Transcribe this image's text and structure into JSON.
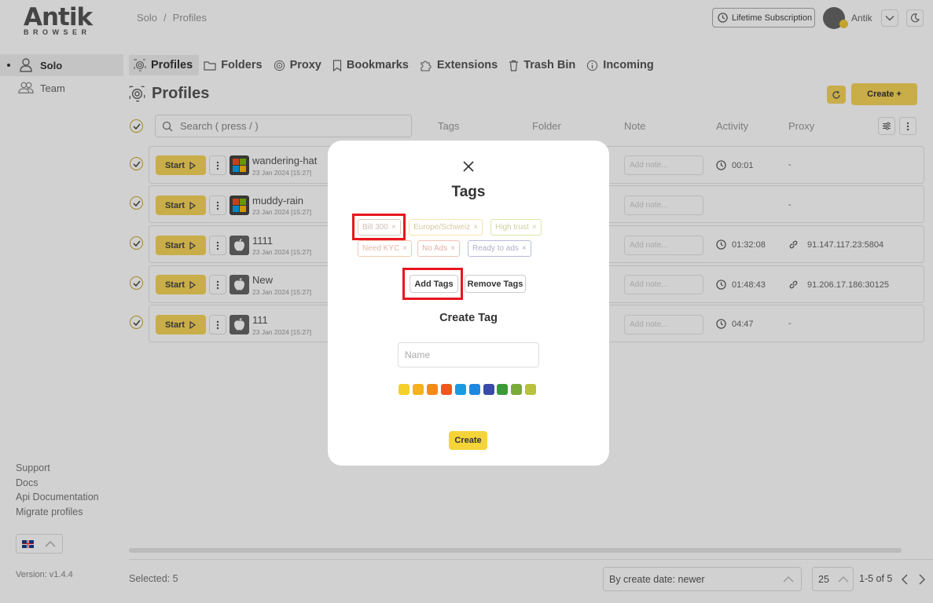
{
  "logo": {
    "main": "Antik",
    "sub": "BROWSER"
  },
  "sidebar": {
    "items": [
      {
        "label": "Solo",
        "active": true
      },
      {
        "label": "Team",
        "active": false
      }
    ],
    "footer_links": [
      "Support",
      "Docs",
      "Api Documentation",
      "Migrate profiles"
    ],
    "version": "Version: v1.4.4"
  },
  "header": {
    "breadcrumb": [
      "Solo",
      "Profiles"
    ],
    "subscription": "Lifetime Subscription",
    "username": "Antik"
  },
  "tabs": [
    "Profiles",
    "Folders",
    "Proxy",
    "Bookmarks",
    "Extensions",
    "Trash Bin",
    "Incoming"
  ],
  "page_title": "Profiles",
  "create_button": "Create +",
  "search": {
    "placeholder": "Search ( press / )"
  },
  "columns": [
    "Tags",
    "Folder",
    "Note",
    "Activity",
    "Proxy"
  ],
  "start_label": "Start",
  "note_placeholder": "Add note...",
  "rows": [
    {
      "name": "wandering-hat",
      "date": "23 Jan 2024 [15:27]",
      "os": "windows",
      "activity": "00:01",
      "proxy": "-"
    },
    {
      "name": "muddy-rain",
      "date": "23 Jan 2024 [15:27]",
      "os": "windows",
      "activity": "",
      "proxy": "-"
    },
    {
      "name": "1111",
      "date": "23 Jan 2024 [15:27]",
      "os": "apple",
      "activity": "01:32:08",
      "proxy": "91.147.117.23:5804"
    },
    {
      "name": "New",
      "date": "23 Jan 2024 [15:27]",
      "os": "apple",
      "activity": "01:48:43",
      "proxy": "91.206.17.186:30125"
    },
    {
      "name": "111",
      "date": "23 Jan 2024 [15:27]",
      "os": "apple",
      "activity": "04:47",
      "proxy": "-"
    }
  ],
  "footer": {
    "selected": "Selected: 5",
    "sort": "By create date: newer",
    "per_page": "25",
    "pagination": "1-5 of 5"
  },
  "modal": {
    "title": "Tags",
    "tags": [
      {
        "label": "Bill 300",
        "color": "#d8c8c0"
      },
      {
        "label": "Europe/Schweiz",
        "color": "#f5e4a8"
      },
      {
        "label": "High trust",
        "color": "#e0e6a8"
      },
      {
        "label": "Need KYC",
        "color": "#f5c8b0"
      },
      {
        "label": "No Ads",
        "color": "#f5c0b8"
      },
      {
        "label": "Ready to ads",
        "color": "#b8bcd8"
      }
    ],
    "add_tags": "Add Tags",
    "remove_tags": "Remove Tags",
    "create_tag_title": "Create Tag",
    "name_placeholder": "Name",
    "swatches": [
      "#f5d02a",
      "#f5b21a",
      "#f58a1a",
      "#f0571e",
      "#1a9ae0",
      "#1e88e0",
      "#3a4aa8",
      "#3a9a3a",
      "#7aaa3a",
      "#b8c23a"
    ],
    "create_label": "Create"
  }
}
